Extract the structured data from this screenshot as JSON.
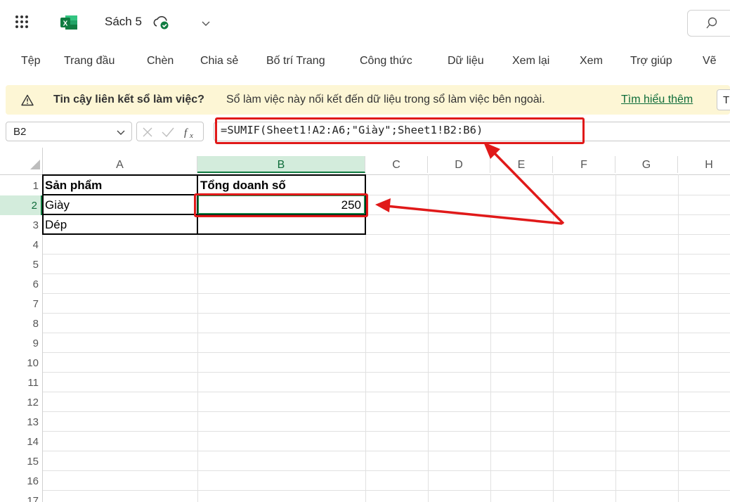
{
  "titlebar": {
    "document_title": "Sách 5"
  },
  "ribbon": {
    "tabs": [
      "Tệp",
      "Trang đầu",
      "Chèn",
      "Chia sẻ",
      "Bố trí Trang",
      "Công thức",
      "Dữ liệu",
      "Xem lại",
      "Xem",
      "Trợ giúp",
      "Vẽ"
    ]
  },
  "warning": {
    "title": "Tin cậy liên kết sổ làm việc?",
    "message": "Sổ làm việc này nối kết đến dữ liệu trong sổ làm việc bên ngoài.",
    "link": "Tìm hiểu thêm",
    "button": "T"
  },
  "formula_bar": {
    "name_box": "B2",
    "formula": "=SUMIF(Sheet1!A2:A6;\"Giày\";Sheet1!B2:B6)"
  },
  "sheet": {
    "columns": [
      "A",
      "B",
      "C",
      "D",
      "E",
      "F",
      "G",
      "H"
    ],
    "selected_column": "B",
    "rows": [
      "1",
      "2",
      "3",
      "4",
      "5",
      "6",
      "7",
      "8",
      "9",
      "10",
      "11",
      "12",
      "13",
      "14",
      "15",
      "16",
      "17"
    ],
    "selected_row": "2",
    "cells": {
      "A1": "Sản phẩm",
      "B1": "Tổng doanh số",
      "A2": "Giày",
      "B2": "250",
      "A3": "Dép"
    }
  },
  "colors": {
    "accent": "#107c41",
    "annotation": "#e01919",
    "warning_bg": "#fdf6d5"
  },
  "icons": [
    "app-launcher-icon",
    "excel-logo-icon",
    "cloud-saved-icon",
    "chevron-down-icon",
    "search-icon",
    "warning-icon",
    "cancel-icon",
    "check-icon",
    "fx-icon"
  ]
}
